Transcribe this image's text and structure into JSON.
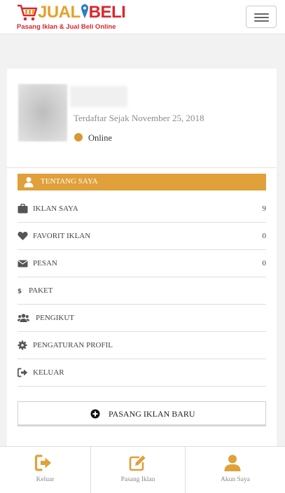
{
  "header": {
    "logo_word_1": "JUAL",
    "logo_word_2": "BELI",
    "logo_tagline": "Pasang Iklan & Jual Beli Online"
  },
  "profile": {
    "registered_text": "Terdaftar Sejak November 25, 2018",
    "status_text": "Online",
    "status_color": "#d79a33"
  },
  "menu": {
    "header_label": "TENTANG SAYA",
    "accent_color": "#e0a03a",
    "items": [
      {
        "label": "IKLAN SAYA",
        "count": "9",
        "icon": "briefcase-icon"
      },
      {
        "label": "FAVORIT IKLAN",
        "count": "0",
        "icon": "heart-icon"
      },
      {
        "label": "PESAN",
        "count": "0",
        "icon": "envelope-icon"
      },
      {
        "label": "PAKET",
        "count": "",
        "icon": "dollar-icon"
      },
      {
        "label": "PENGIKUT",
        "count": "",
        "icon": "users-icon"
      },
      {
        "label": "PENGATURAN PROFIL",
        "count": "",
        "icon": "gear-icon"
      },
      {
        "label": "KELUAR",
        "count": "",
        "icon": "sign-out-icon"
      }
    ]
  },
  "new_ad_button": {
    "label": "PASANG IKLAN BARU",
    "icon": "plus-circle-icon"
  },
  "bottom_nav": {
    "icon_color": "#e0a03a",
    "items": [
      {
        "label": "Keluar",
        "icon": "sign-out-icon"
      },
      {
        "label": "Pasang Iklan",
        "icon": "edit-icon"
      },
      {
        "label": "Akun Saya",
        "icon": "user-icon"
      }
    ]
  }
}
